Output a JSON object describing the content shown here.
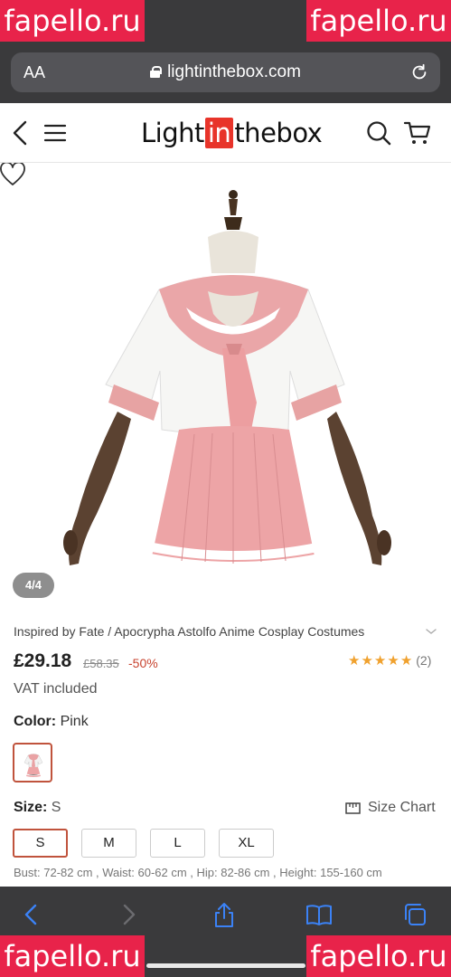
{
  "browser": {
    "text_size_label": "AA",
    "url": "lightinthebox.com"
  },
  "watermark": "fapello.ru",
  "site": {
    "logo_left": "Light",
    "logo_mid": "in",
    "logo_right": "thebox"
  },
  "gallery": {
    "counter": "4/4"
  },
  "product": {
    "title": "Inspired by Fate / Apocrypha Astolfo Anime Cosplay Costumes",
    "price": "£29.18",
    "old_price": "£58.35",
    "discount": "-50%",
    "rating_stars": 5,
    "review_count": "(2)",
    "vat": "VAT included",
    "color_label": "Color:",
    "color_value": "Pink",
    "size_label": "Size:",
    "size_value": "S",
    "size_chart": "Size Chart",
    "sizes": [
      "S",
      "M",
      "L",
      "XL"
    ],
    "selected_size": "S",
    "measurements": "Bust: 72-82 cm , Waist: 60-62 cm , Hip: 82-86 cm , Height: 155-160 cm"
  },
  "colors": {
    "accent": "#c0533c",
    "logo_red": "#e8342a",
    "star": "#f0a12e",
    "discount": "#c8432f",
    "toolbar_icon": "#3b82f6"
  }
}
